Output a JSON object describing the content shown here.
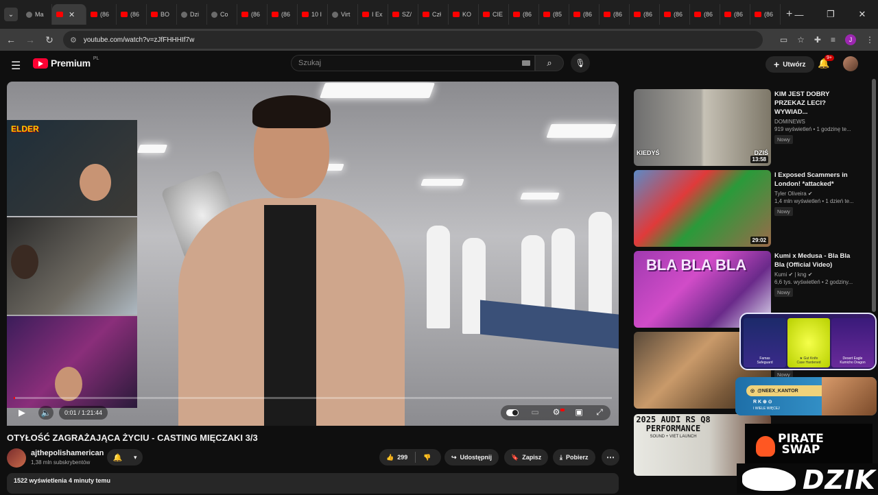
{
  "browser": {
    "tabs": [
      {
        "label": "Ma",
        "icon": "other"
      },
      {
        "label": "",
        "icon": "youtube",
        "active": true
      },
      {
        "label": "(86",
        "icon": "youtube"
      },
      {
        "label": "(86",
        "icon": "youtube"
      },
      {
        "label": "BO",
        "icon": "youtube"
      },
      {
        "label": "Dzi",
        "icon": "other"
      },
      {
        "label": "Co",
        "icon": "other"
      },
      {
        "label": "(86",
        "icon": "youtube"
      },
      {
        "label": "(86",
        "icon": "youtube"
      },
      {
        "label": "10 I",
        "icon": "youtube"
      },
      {
        "label": "Virt",
        "icon": "other"
      },
      {
        "label": "I Ex",
        "icon": "youtube"
      },
      {
        "label": "SZ/",
        "icon": "youtube"
      },
      {
        "label": "Czł",
        "icon": "youtube"
      },
      {
        "label": "KO",
        "icon": "youtube"
      },
      {
        "label": "CIE",
        "icon": "youtube"
      },
      {
        "label": "(86",
        "icon": "youtube"
      },
      {
        "label": "(85",
        "icon": "youtube"
      },
      {
        "label": "(86",
        "icon": "youtube"
      },
      {
        "label": "(86",
        "icon": "youtube"
      },
      {
        "label": "(86",
        "icon": "youtube"
      },
      {
        "label": "(86",
        "icon": "youtube"
      },
      {
        "label": "(86",
        "icon": "youtube"
      },
      {
        "label": "(86",
        "icon": "youtube"
      },
      {
        "label": "(86",
        "icon": "youtube"
      }
    ],
    "url": "youtube.com/watch?v=zJfFHHHIf7w",
    "profile_letter": "J"
  },
  "header": {
    "brand": "Premium",
    "region": "PL",
    "search_placeholder": "Szukaj",
    "create_label": "Utwórz",
    "notifications": "9+"
  },
  "player": {
    "time": "0:01 / 1:21:44",
    "progress": 0.0002,
    "webcam_logo": "ELDER"
  },
  "video": {
    "title": "OTYŁOŚĆ ZAGRAŻAJĄCA ŻYCIU - CASTING MIĘCZAKI 3/3",
    "channel": "ajthepolishamerican",
    "subscribers": "1,38 mln subskrybentów",
    "likes": "299",
    "share_label": "Udostępnij",
    "save_label": "Zapisz",
    "download_label": "Pobierz",
    "views_time": "1522 wyświetlenia  4 minuty temu"
  },
  "recommendations": [
    {
      "title": "KIM JEST DOBRY PRZEKAZ LECI? WYWIAD...",
      "channel": "DOMINEWS",
      "verified": false,
      "meta": "919 wyświetleń • 1 godzinę te...",
      "badge": "Nowy",
      "duration": "13:58",
      "labels": [
        "KIEDYŚ",
        "DZIŚ"
      ]
    },
    {
      "title": "I Exposed Scammers in London! *attacked*",
      "channel": "Tyler Oliveira",
      "verified": true,
      "meta": "1,4 mln wyświetleń • 1 dzień te...",
      "badge": "Nowy",
      "duration": "29:02",
      "labels": []
    },
    {
      "title": "Kumi x Medusa - Bla Bla Bla (Official Video)",
      "channel": "Kumi",
      "channel2": "| kng",
      "verified": true,
      "meta": "6,6 tys. wyświetleń • 2 godziny...",
      "badge": "Nowy",
      "duration": "",
      "labels": [
        "BLA BLA BLA"
      ]
    },
    {
      "title": "",
      "channel": "",
      "meta": "",
      "badge": "Nowy",
      "duration": "",
      "labels": []
    },
    {
      "title": "",
      "channel": "",
      "meta": "",
      "badge": "",
      "duration": "",
      "labels": [
        "2025 AUDI RS Q8",
        "PERFORMANCE",
        "SOUND + VIET LAUNCH"
      ]
    }
  ],
  "overlays": {
    "skins": [
      {
        "name": "Famas",
        "sub": "Safeguard"
      },
      {
        "name": "★ Gut Knife",
        "sub": "Case Hardened"
      },
      {
        "name": "Desert Eagle",
        "sub": "Kumicho Dragon"
      }
    ],
    "instagram": "@NEEX_KANTOR",
    "social_row": "R  K  ⊕  ⊙",
    "social_sub": "I WIELE WIĘCEJ",
    "pirate_line1": "PIRATE",
    "pirate_line2": "SWAP",
    "dzik": "DZIK"
  },
  "colors": {
    "accent": "#ff0000",
    "bg": "#0f0f0f",
    "chip": "#272727"
  }
}
